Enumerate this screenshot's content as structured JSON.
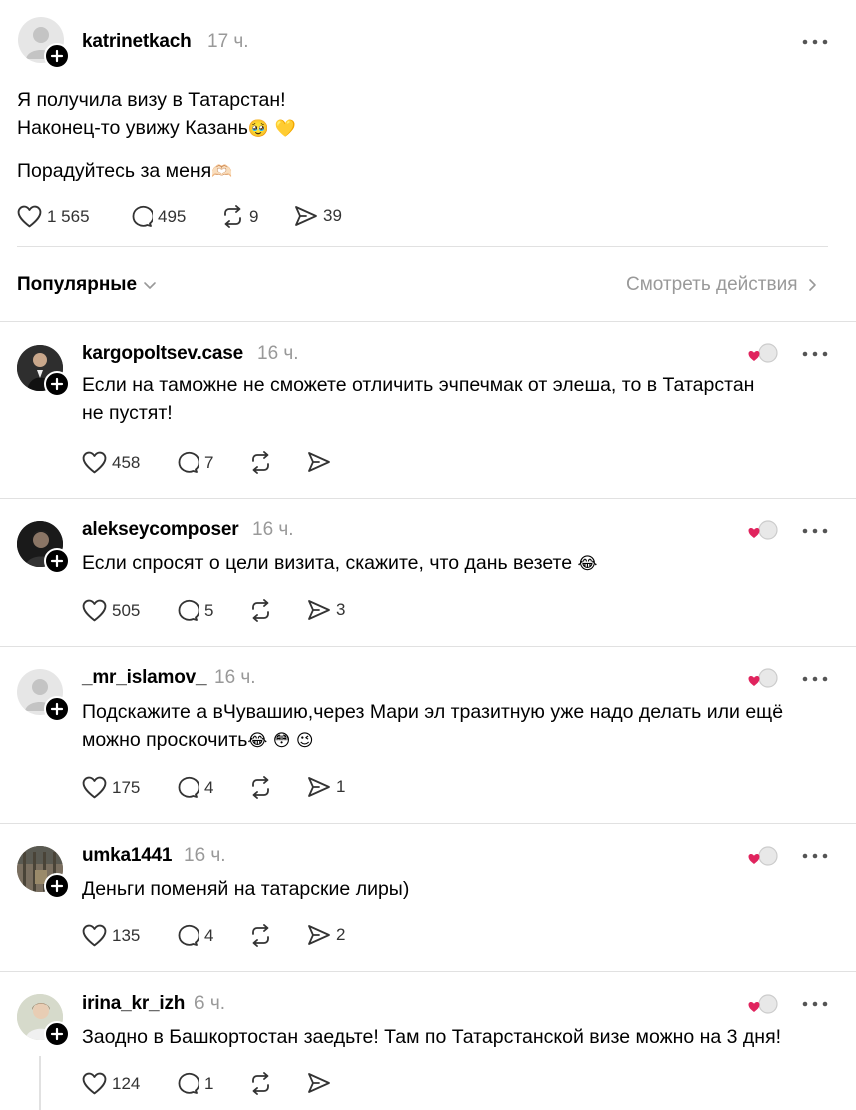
{
  "post": {
    "username": "katrinetkach",
    "time": "17 ч.",
    "text_line1": "Я получила визу в Татарстан!",
    "text_line2": "Наконец-то увижу Казань",
    "text_line2_emoji": "🥹 💛",
    "text_line3": "Порадуйтесь за меня",
    "text_line3_emoji": "🫶🏻",
    "likes": "1 565",
    "comments": "495",
    "reposts": "9",
    "shares": "39"
  },
  "sort": {
    "label": "Популярные",
    "view_activity": "Смотреть действия"
  },
  "replies": [
    {
      "username": "kargopoltsev.case",
      "time": "16 ч.",
      "line1": "Если на таможне не сможете отличить эчпечмак от элеша, то в Татарстан",
      "line2": "не пустят!",
      "likes": "458",
      "comments": "7",
      "reposts": "",
      "shares": "",
      "avatar": "photo"
    },
    {
      "username": "alekseycomposer",
      "time": "16 ч.",
      "line1": "Если спросят о цели визита, скажите, что дань везете",
      "line1_emoji": "😂",
      "line2": "",
      "likes": "505",
      "comments": "5",
      "reposts": "",
      "shares": "3",
      "avatar": "photo"
    },
    {
      "username": "_mr_islamov_",
      "time": "16 ч.",
      "line1": "Подскажите а вЧувашию,через Мари эл тразитную уже надо делать или ещё",
      "line2": "можно проскочить",
      "line2_emoji": "😂 😳 😉",
      "likes": "175",
      "comments": "4",
      "reposts": "",
      "shares": "1",
      "avatar": "default"
    },
    {
      "username": "umka1441",
      "time": "16 ч.",
      "line1": "Деньги поменяй на татарские лиры)",
      "line2": "",
      "likes": "135",
      "comments": "4",
      "reposts": "",
      "shares": "2",
      "avatar": "photo"
    },
    {
      "username": "irina_kr_izh",
      "time": "6 ч.",
      "line1": "Заодно в Башкортостан заедьте! Там по Татарстанской визе можно на 3 дня!",
      "line2": "",
      "likes": "124",
      "comments": "1",
      "reposts": "",
      "shares": "",
      "avatar": "photo"
    }
  ],
  "colors": {
    "heart_red": "#e0245e",
    "muted": "#999999",
    "divider": "#e1e1e1"
  },
  "icons": [
    "more-icon",
    "heart-icon",
    "comment-icon",
    "repost-icon",
    "share-icon",
    "chevron-down-icon",
    "chevron-right-icon",
    "follow-plus-icon",
    "liked-by-author-icon"
  ]
}
